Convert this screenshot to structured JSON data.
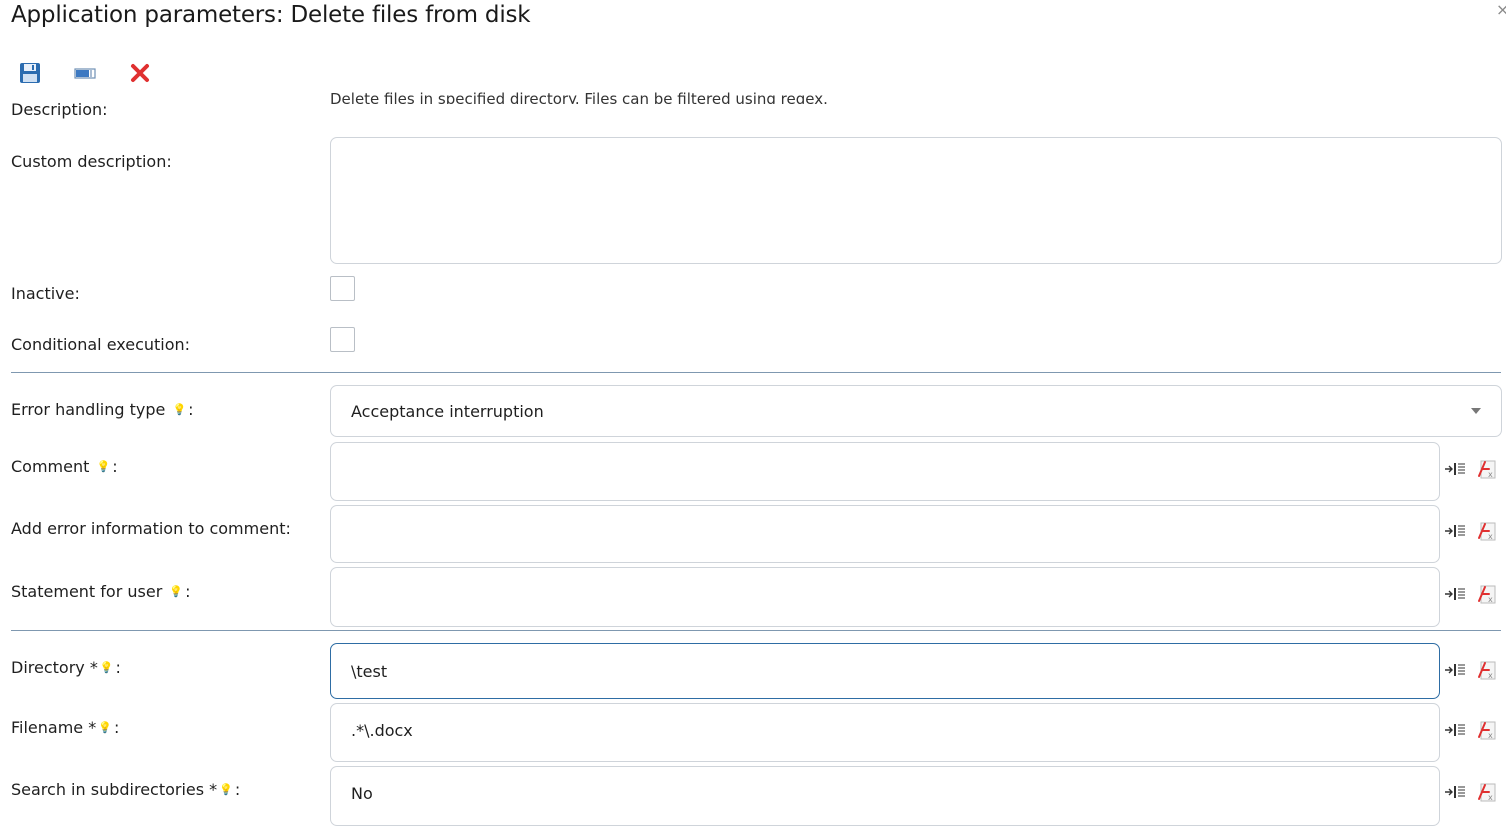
{
  "dialog": {
    "title": "Application parameters: Delete files from disk",
    "close_glyph": "×"
  },
  "toolbar": {
    "icons": [
      "save-icon",
      "window-icon",
      "cancel-icon"
    ]
  },
  "colors": {
    "accent": "#2e6da4",
    "divider": "#7f98b0",
    "cancel_red": "#e03030",
    "save_blue": "#2b6cb0"
  },
  "fields": {
    "description": {
      "label": "Description:",
      "value": "Delete files in specified directory. Files can be filtered using regex."
    },
    "custom_description": {
      "label": "Custom description:",
      "value": ""
    },
    "inactive": {
      "label": "Inactive:",
      "checked": false
    },
    "conditional_execution": {
      "label": "Conditional execution:",
      "checked": false
    },
    "error_handling_type": {
      "label": "Error handling type",
      "label_suffix": ":",
      "selected": "Acceptance interruption"
    },
    "comment": {
      "label": "Comment",
      "label_suffix": ":",
      "value": ""
    },
    "add_error_info": {
      "label": "Add error information to comment:",
      "value": ""
    },
    "statement_for_user": {
      "label": "Statement for user",
      "label_suffix": ":",
      "value": ""
    },
    "directory": {
      "label": "Directory *",
      "label_suffix": ":",
      "value": "\\test"
    },
    "filename": {
      "label": "Filename *",
      "label_suffix": ":",
      "value": ".*\\.docx"
    },
    "search_subdirectories": {
      "label": "Search in subdirectories *",
      "label_suffix": ":",
      "value": "No"
    }
  },
  "side_icons": [
    "insert-variable-icon",
    "formula-icon"
  ]
}
